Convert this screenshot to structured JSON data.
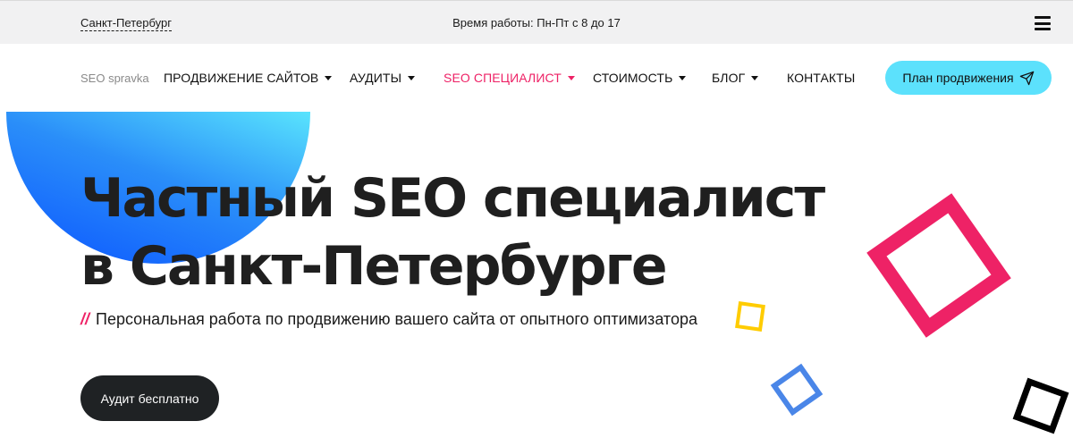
{
  "topbar": {
    "city": "Санкт-Петербург",
    "hours": "Время работы: Пн-Пт с 8 до 17",
    "menu_icon": "hamburger-icon"
  },
  "nav": {
    "logo": "SEO spravka",
    "items": [
      {
        "label": "ПРОДВИЖЕНИЕ САЙТОВ",
        "has_dropdown": true,
        "active": false
      },
      {
        "label": "АУДИТЫ",
        "has_dropdown": true,
        "active": false
      },
      {
        "label": "SEO СПЕЦИАЛИСТ",
        "has_dropdown": true,
        "active": true
      },
      {
        "label": "СТОИМОСТЬ",
        "has_dropdown": true,
        "active": false
      },
      {
        "label": "БЛОГ",
        "has_dropdown": true,
        "active": false
      },
      {
        "label": "КОНТАКТЫ",
        "has_dropdown": false,
        "active": false
      }
    ],
    "cta_label": "План продвижения",
    "cta_icon": "paper-plane-icon"
  },
  "hero": {
    "title_line1": "Частный SEO специалист",
    "title_line2": "в Санкт-Петербурге",
    "subtitle_marker": "//",
    "subtitle": "Персональная работа по продвижению вашего сайта от опытного оптимизатора",
    "button_label": "Аудит бесплатно"
  },
  "colors": {
    "accent_pink": "#ee2266",
    "cta_cyan": "#5ce1fc",
    "dark_button": "#1f2224",
    "topbar_bg": "#f1f1f2",
    "square_yellow": "#ffcc00",
    "square_blue": "#4a86e8",
    "square_black": "#000000"
  }
}
